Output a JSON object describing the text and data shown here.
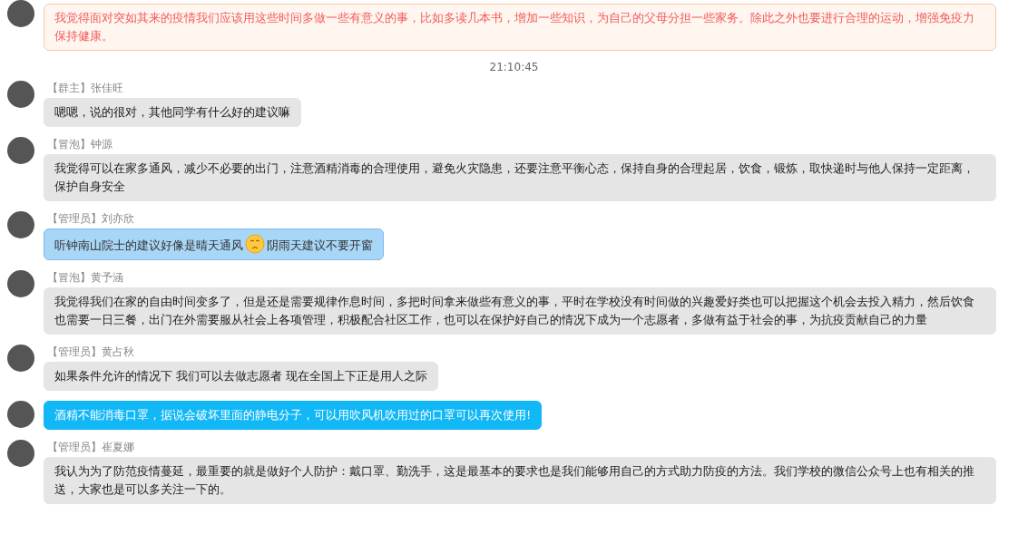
{
  "messages": [
    {
      "kind": "pink",
      "segments": [
        {
          "kind": "text",
          "text": "我觉得面对突如其来的疫情我们应该用这些时间多做一些有意义的事，比如多读几本书，增加一些知识，为自己的父母分担一些家务。除此之外也要进行合理的运动，增强免疫力保持健康。"
        }
      ]
    },
    {
      "kind": "time",
      "time": "21:10:45"
    },
    {
      "role": "【群主】",
      "name": "张佳旺",
      "kind": "gray",
      "segments": [
        {
          "kind": "text",
          "text": "嗯嗯，说的很对，其他同学有什么好的建议嘛"
        }
      ]
    },
    {
      "role": "【冒泡】",
      "name": "钟源",
      "kind": "gray",
      "segments": [
        {
          "kind": "text",
          "text": "我觉得可以在家多通风，减少不必要的出门，注意酒精消毒的合理使用，避免火灾隐患，还要注意平衡心态，保持自身的合理起居，饮食，锻炼，取快递时与他人保持一定距离，保护自身安全"
        }
      ]
    },
    {
      "role": "【管理员】",
      "name": "刘亦欣",
      "kind": "sky",
      "segments": [
        {
          "kind": "text",
          "text": "听钟南山院士的建议好像是晴天通风"
        },
        {
          "kind": "emoji"
        },
        {
          "kind": "text",
          "text": "阴雨天建议不要开窗"
        }
      ]
    },
    {
      "role": "【冒泡】",
      "name": "黄予涵",
      "kind": "gray",
      "segments": [
        {
          "kind": "text",
          "text": "我觉得我们在家的自由时间变多了，但是还是需要规律作息时间，多把时间拿来做些有意义的事，平时在学校没有时间做的兴趣爱好类也可以把握这个机会去投入精力，然后饮食也需要一日三餐，出门在外需要服从社会上各项管理，积极配合社区工作，也可以在保护好自己的情况下成为一个志愿者，多做有益于社会的事，为抗疫贡献自己的力量"
        }
      ]
    },
    {
      "role": "【管理员】",
      "name": "黄占秋",
      "kind": "gray",
      "segments": [
        {
          "kind": "text",
          "text": "如果条件允许的情况下 我们可以去做志愿者 现在全国上下正是用人之际"
        }
      ]
    },
    {
      "kind": "cyan",
      "segments": [
        {
          "kind": "text",
          "text": "酒精不能消毒口罩，据说会破坏里面的静电分子，可以用吹风机吹用过的口罩可以再次使用!"
        }
      ]
    },
    {
      "role": "【管理员】",
      "name": "崔夏娜",
      "kind": "gray",
      "segments": [
        {
          "kind": "text",
          "text": "我认为为了防范疫情蔓延，最重要的就是做好个人防护：戴口罩、勤洗手，这是最基本的要求也是我们能够用自己的方式助力防疫的方法。我们学校的微信公众号上也有相关的推送，大家也是可以多关注一下的。"
        }
      ]
    }
  ]
}
